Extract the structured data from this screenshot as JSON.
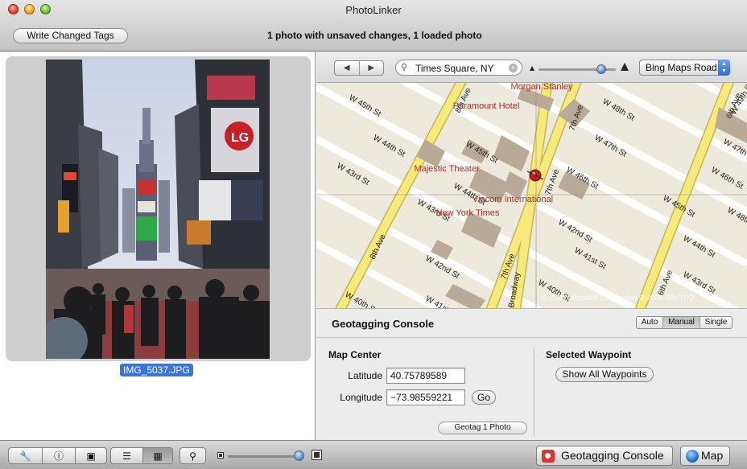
{
  "window": {
    "title": "PhotoLinker"
  },
  "toolbar": {
    "write_label": "Write Changed Tags",
    "status": "1 photo with unsaved changes, 1 loaded photo"
  },
  "photo": {
    "filename": "IMG_5037.JPG"
  },
  "map_toolbar": {
    "back_glyph": "◀",
    "forward_glyph": "▶",
    "search_value": "Times Square, NY",
    "map_type": "Bing Maps Road"
  },
  "map": {
    "labels": {
      "w45": "W 45th St",
      "w44": "W 44th St",
      "w43": "W 43rd St",
      "w43b": "W 43rd St",
      "w42": "W 42nd St",
      "w40": "W 40th St",
      "w41": "W 41st St",
      "w46": "W 46th St",
      "w47": "W 47th St",
      "w48": "W 48th St",
      "w45b": "W 45th St",
      "w44b": "W 44th St",
      "w44c": "W 44th St",
      "w45c": "W 45th St",
      "w42b": "W 42nd St",
      "w41b": "W 41st St",
      "w40b": "W 40th St",
      "w46b": "W 46th St",
      "w47b": "W 47th St",
      "w48b": "W 48th St",
      "w49": "W 49th St",
      "w43c": "W 43rd St",
      "ave8": "8th Ave",
      "ave8b": "8th Ave",
      "ave7": "7th Ave",
      "ave7b": "7th Ave",
      "ave7c": "7th Ave",
      "ave6": "6th Ave",
      "ave6b": "6th Ave",
      "broadway": "Broadway",
      "paramount": "Paramount Hotel",
      "morgan": "Morgan Stanley",
      "majestic": "Majestic Theater",
      "viacom": "Viacom International",
      "nyt": "New York Times"
    },
    "credit": "© 2009 Microsoft Corporation  © 2009 NAVTEQ"
  },
  "console": {
    "title": "Geotagging Console",
    "modes": [
      "Auto",
      "Manual",
      "Single"
    ],
    "selected_mode": "Manual",
    "map_center_title": "Map Center",
    "latitude_label": "Latitude",
    "latitude_value": "40.75789589",
    "longitude_label": "Longitude",
    "longitude_value": "−73.98559221",
    "go_label": "Go",
    "geotag_label": "Geotag 1 Photo",
    "waypoint_title": "Selected Waypoint",
    "show_waypoints_label": "Show All Waypoints"
  },
  "bottombar": {
    "geotagging_console_label": "Geotagging Console",
    "map_label": "Map",
    "thumbnail_size": 0.87
  },
  "colors": {
    "selection_blue": "#3a74d6",
    "map_road_yellow": "#f7ea7a",
    "map_building": "#b9aa98",
    "map_label_red": "#a8312a"
  }
}
